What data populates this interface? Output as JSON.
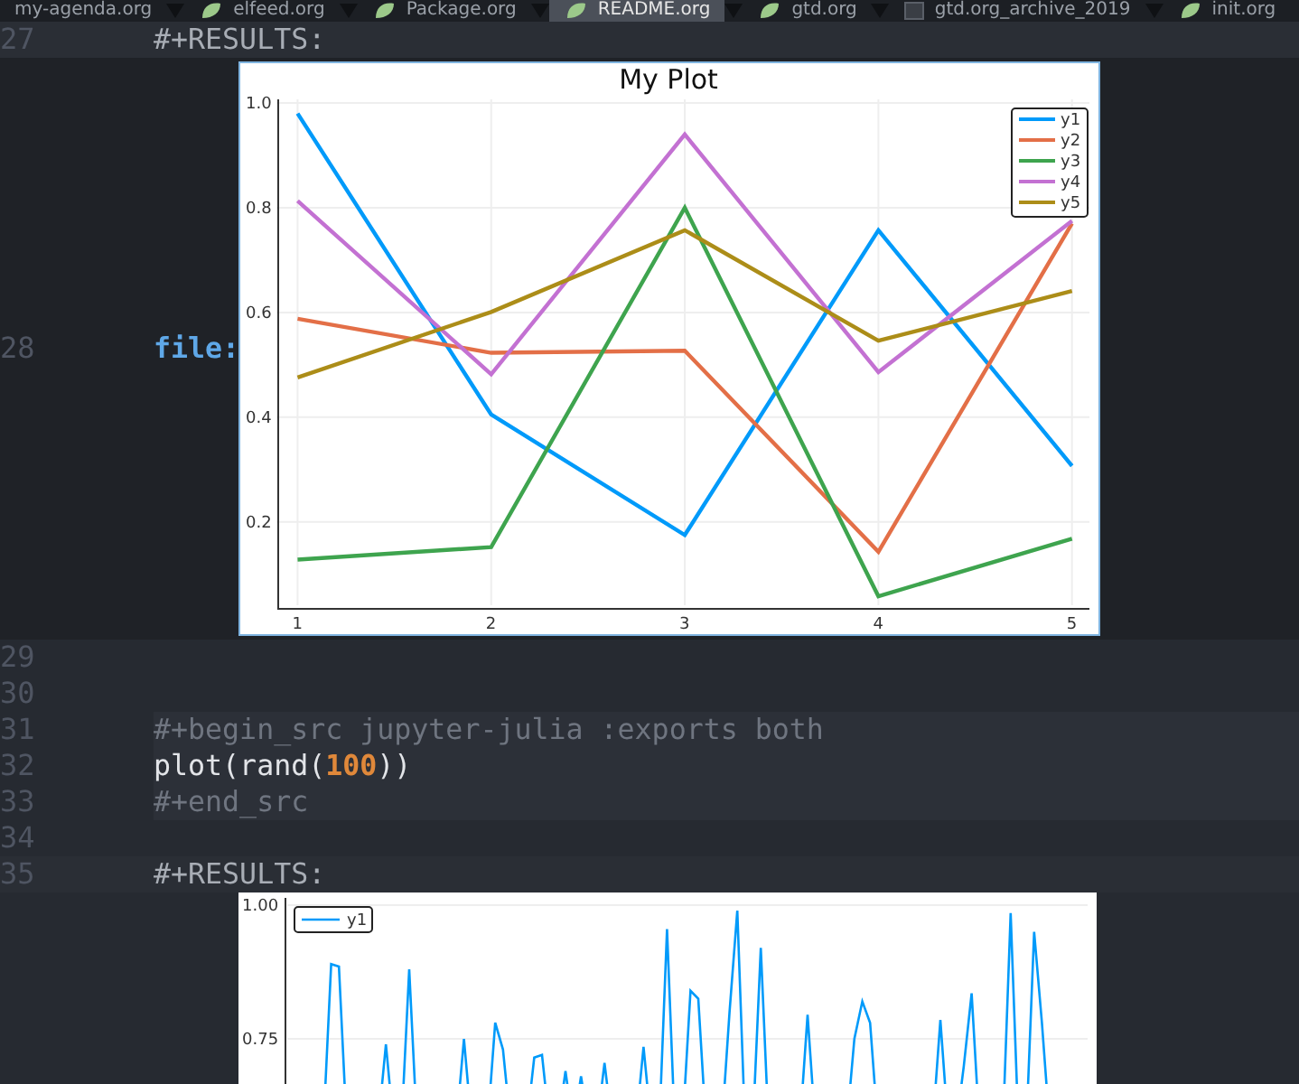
{
  "tabs": [
    {
      "label": "my-agenda.org",
      "kind": "clipped",
      "selected": false
    },
    {
      "label": "elfeed.org",
      "kind": "org",
      "selected": false
    },
    {
      "label": "Package.org",
      "kind": "org",
      "selected": false
    },
    {
      "label": "README.org",
      "kind": "org",
      "selected": true
    },
    {
      "label": "gtd.org",
      "kind": "org",
      "selected": false
    },
    {
      "label": "gtd.org_archive_2019",
      "kind": "archive",
      "selected": false
    },
    {
      "label": "init.org",
      "kind": "org",
      "selected": false
    }
  ],
  "editor": {
    "lines": [
      {
        "number": "27",
        "kind": "results",
        "text": "#+RESULTS:"
      },
      {
        "number": "28",
        "kind": "image",
        "link": "file:",
        "chart_data": {
          "type": "line",
          "title": "My Plot",
          "grid": true,
          "legend": true,
          "x": [
            1,
            2,
            3,
            4,
            5
          ],
          "xlim": [
            0.9,
            5.09
          ],
          "xticks": [
            1,
            2,
            3,
            4,
            5
          ],
          "ylim": [
            0.034,
            1.007
          ],
          "yticks": [
            {
              "value": 0.2,
              "label": "0.2"
            },
            {
              "value": 0.4,
              "label": "0.4"
            },
            {
              "value": 0.6,
              "label": "0.6"
            },
            {
              "value": 0.8,
              "label": "0.8"
            },
            {
              "value": 1.0,
              "label": "1.0"
            }
          ],
          "series": [
            {
              "name": "y1",
              "color": "#009afa",
              "values": [
                0.98,
                0.405,
                0.175,
                0.757,
                0.307
              ]
            },
            {
              "name": "y2",
              "color": "#e36f47",
              "values": [
                0.588,
                0.523,
                0.527,
                0.143,
                0.77
              ]
            },
            {
              "name": "y3",
              "color": "#3ea44e",
              "values": [
                0.128,
                0.152,
                0.8,
                0.058,
                0.168
              ]
            },
            {
              "name": "y4",
              "color": "#c371d2",
              "values": [
                0.813,
                0.482,
                0.94,
                0.486,
                0.775
              ]
            },
            {
              "name": "y5",
              "color": "#ac8d18",
              "values": [
                0.476,
                0.601,
                0.757,
                0.546,
                0.641
              ]
            }
          ]
        }
      },
      {
        "number": "29",
        "kind": "empty"
      },
      {
        "number": "30",
        "kind": "empty"
      },
      {
        "number": "31",
        "kind": "src-keyword",
        "text": "#+begin_src jupyter-julia :exports both"
      },
      {
        "number": "32",
        "kind": "src-code",
        "text": "plot(rand(**100**))"
      },
      {
        "number": "33",
        "kind": "src-keyword",
        "text": "#+end_src"
      },
      {
        "number": "34",
        "kind": "empty"
      },
      {
        "number": "35",
        "kind": "results",
        "text": "#+RESULTS:"
      },
      {
        "kind": "plot",
        "y_tick_labels": [
          "1.00",
          "0.75"
        ],
        "legend": "y1"
      }
    ]
  }
}
